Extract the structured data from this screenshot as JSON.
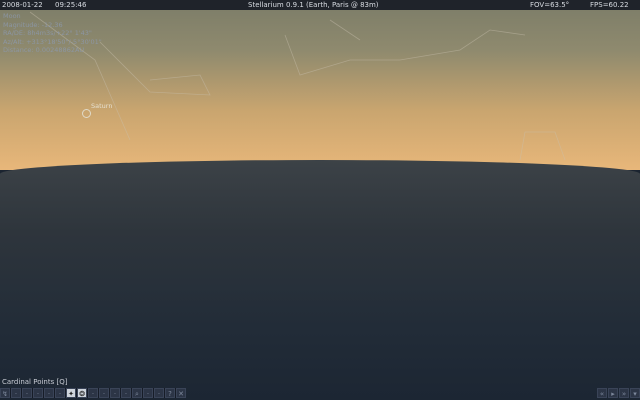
{
  "topbar": {
    "date": "2008-01-22",
    "time": "09:25:46",
    "title": "Stellarium 0.9.1 (Earth, Paris @ 83m)",
    "fov": "FOV=63.5°",
    "fps": "FPS=60.22"
  },
  "info": {
    "name": "Moon",
    "magnitude": "Magnitude: -12.36",
    "radec": "RA/DE: 8h4m3s/+22° 1'43\"",
    "azalt": "Az/Alt: +313°18'50\"/-5°30'01\"",
    "distance": "Distance: 0.00248862AU"
  },
  "sky": {
    "planet_label": "Saturn"
  },
  "toolbar": {
    "tooltip": "Cardinal Points [Q]",
    "buttons": [
      {
        "icon": "constellation-lines-icon"
      },
      {
        "icon": "constellation-art-icon"
      },
      {
        "icon": "constellation-labels-icon"
      },
      {
        "icon": "equatorial-grid-icon"
      },
      {
        "icon": "azimuthal-grid-icon"
      },
      {
        "icon": "ground-icon"
      },
      {
        "icon": "cardinal-points-icon",
        "active": true
      },
      {
        "icon": "atmosphere-icon",
        "active": true
      },
      {
        "icon": "nebulae-icon"
      },
      {
        "icon": "planet-labels-icon"
      },
      {
        "icon": "mount-icon"
      },
      {
        "icon": "goto-icon"
      },
      {
        "icon": "search-icon"
      },
      {
        "icon": "config-icon"
      },
      {
        "icon": "night-mode-icon"
      },
      {
        "icon": "help-icon"
      },
      {
        "icon": "quit-icon"
      }
    ],
    "time_buttons": [
      {
        "icon": "rewind-icon"
      },
      {
        "icon": "play-icon"
      },
      {
        "icon": "fast-forward-icon"
      },
      {
        "icon": "now-icon"
      }
    ]
  }
}
